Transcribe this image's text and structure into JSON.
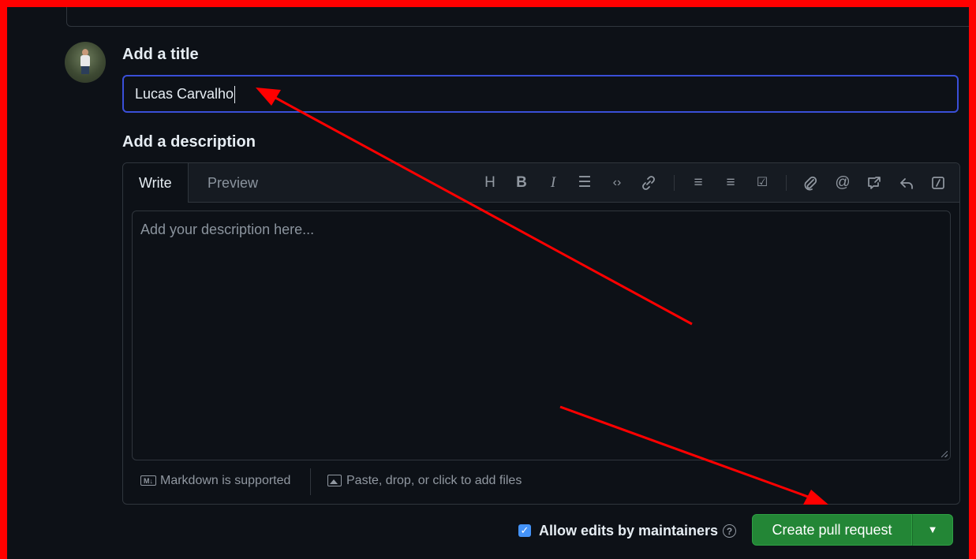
{
  "form": {
    "title_label": "Add a title",
    "title_value": "Lucas Carvalho",
    "description_label": "Add a description",
    "description_placeholder": "Add your description here..."
  },
  "editor": {
    "tabs": [
      {
        "label": "Write",
        "active": true
      },
      {
        "label": "Preview",
        "active": false
      }
    ],
    "toolbar": [
      {
        "icon": "heading-icon",
        "glyph": "H"
      },
      {
        "icon": "bold-icon",
        "glyph": "B"
      },
      {
        "icon": "italic-icon",
        "glyph": "I"
      },
      {
        "icon": "quote-icon",
        "glyph": "☰"
      },
      {
        "icon": "code-icon",
        "glyph": "‹›"
      },
      {
        "icon": "link-icon",
        "glyph": "🔗"
      },
      {
        "icon": "numbered-list-icon",
        "glyph": "≡"
      },
      {
        "icon": "unordered-list-icon",
        "glyph": "≡"
      },
      {
        "icon": "task-list-icon",
        "glyph": "☑"
      },
      {
        "icon": "attach-icon",
        "glyph": "📎"
      },
      {
        "icon": "mention-icon",
        "glyph": "@"
      },
      {
        "icon": "cross-reference-icon",
        "glyph": "⇗"
      },
      {
        "icon": "reply-icon",
        "glyph": "↩"
      },
      {
        "icon": "slash-command-icon",
        "glyph": "⧄"
      }
    ],
    "markdown_note": "Markdown is supported",
    "attach_note": "Paste, drop, or click to add files"
  },
  "actions": {
    "allow_edits_label": "Allow edits by maintainers",
    "allow_edits_checked": true,
    "create_label": "Create pull request"
  },
  "colors": {
    "background": "#0d1117",
    "accent_button": "#238636",
    "focus_border": "#3a4fd8",
    "annotation_arrow": "#ff0000",
    "frame": "#ff0000"
  }
}
